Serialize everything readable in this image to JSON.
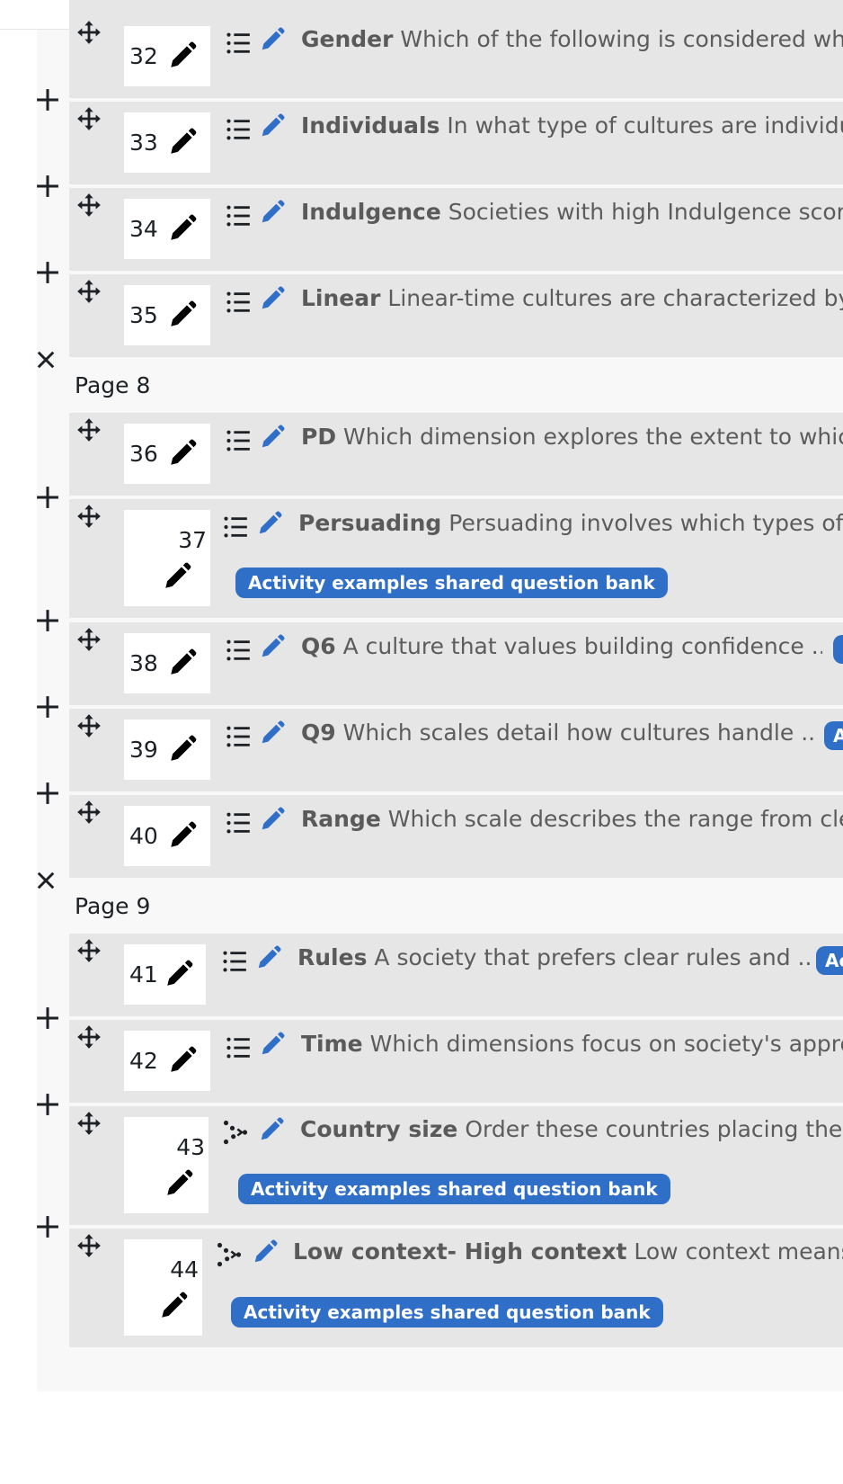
{
  "page_sections": [
    {
      "label": "Page 8"
    },
    {
      "label": "Page 9"
    }
  ],
  "badge_label": "Activity examples shared question bank",
  "questions": [
    {
      "number": "32",
      "name": "Gender",
      "text": "Which of the following is considered whe",
      "badge": ""
    },
    {
      "number": "33",
      "name": "Individuals",
      "text": "In what type of cultures are individua",
      "badge": ""
    },
    {
      "number": "34",
      "name": "Indulgence",
      "text": "Societies with high Indulgence score",
      "badge": ""
    },
    {
      "number": "35",
      "name": "Linear",
      "text": "Linear-time cultures are characterized by:",
      "badge": ""
    },
    {
      "number": "36",
      "name": "PD",
      "text": "Which dimension explores the extent to which",
      "badge": ""
    },
    {
      "number": "37",
      "name": "Persuading",
      "text": "Persuading involves which types of r",
      "badge": "Activity examples shared question bank"
    },
    {
      "number": "38",
      "name": "Q6",
      "text": "A culture that values building confidence ...",
      "badge": ""
    },
    {
      "number": "39",
      "name": "Q9",
      "text": "Which scales detail how cultures handle ...",
      "badge": "A"
    },
    {
      "number": "40",
      "name": "Range",
      "text": "Which scale describes the range from clea",
      "badge": ""
    },
    {
      "number": "41",
      "name": "Rules",
      "text": "A society that prefers clear rules and ...",
      "badge": "Ac"
    },
    {
      "number": "42",
      "name": "Time",
      "text": "Which dimensions focus on society's appro",
      "badge": ""
    },
    {
      "number": "43",
      "name": "Country size",
      "text": "Order these countries placing the la",
      "badge": "Activity examples shared question bank"
    },
    {
      "number": "44",
      "name": "Low context- High context",
      "text": "Low context means th",
      "badge": "Activity examples shared question bank"
    }
  ],
  "icons": {
    "move": "move-icon",
    "edit_number": "pencil-icon",
    "multichoice": "list-icon",
    "ordering": "ordering-icon",
    "edit_question": "edit-icon",
    "add": "plus-icon",
    "remove_page_break": "close-icon"
  },
  "colors": {
    "accent": "#2f6fc7",
    "row_bg": "#e6e6e6",
    "panel_bg": "#f8f8f8"
  }
}
